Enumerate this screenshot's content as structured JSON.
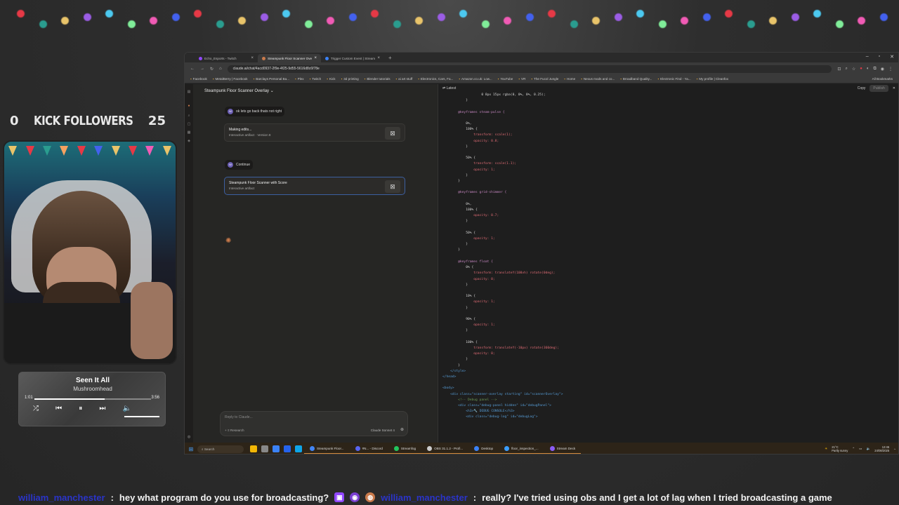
{
  "overlay": {
    "followers_left": "0",
    "followers_label": "KICK FOLLOWERS",
    "followers_right": "25"
  },
  "music": {
    "title": "Seen It All",
    "artist": "Mushroomhead",
    "elapsed": "1:01",
    "duration": "3:56",
    "progress": 0.6,
    "icons": [
      "shuffle-icon",
      "previous-icon",
      "pause-icon",
      "next-icon",
      "volume-icon"
    ]
  },
  "browser": {
    "tabs": [
      {
        "label": "Echo_Esports - Twitch",
        "active": false
      },
      {
        "label": "Steampunk Floor Scanner Ove",
        "active": true
      },
      {
        "label": "Trigger Custom Event | Stream",
        "active": false
      }
    ],
    "new_tab": "+",
    "url": "claude.ai/chat/4acd0937-2f9e-4f25-9d55-5616d8c6f78e",
    "bookmarks": [
      "Facebook",
      "MetalBerry | Facebook",
      "Barclays Personal Ba...",
      "Plex",
      "Twitch",
      "Kick",
      "3d printing",
      "Blender tutorials",
      "ai art stuff",
      "Electronics, Cars, Fa...",
      "Amazon.co.uk: Low...",
      "YouTube",
      "VR",
      "The Fucol Jungle",
      "Home",
      "Nexus mods and co...",
      "Broadband Quality...",
      "Electronic Find - Ya...",
      "My profile | Cleanfox"
    ],
    "all_bookmarks": "All Bookmarks"
  },
  "claude": {
    "chat_title": "Steampunk Floor Scanner Overlay",
    "messages": [
      {
        "avatar": "W",
        "text": "ok lets go back thats not right"
      },
      {
        "avatar": "W",
        "text": "Continue"
      }
    ],
    "artifacts": [
      {
        "title": "Making edits...",
        "subtitle": "Interactive artifact · Version 8"
      },
      {
        "title": "Steampunk Floor Scanner with Score",
        "subtitle": "Interactive artifact"
      }
    ],
    "reply_placeholder": "Reply to Claude...",
    "tools_label": "+ ≡ Research",
    "model_label": "Claude Sonnet 4",
    "code_panel": {
      "version": "Latest",
      "copy": "Copy",
      "publish": "Publish",
      "lines": [
        "                    0 8px 15px rgba(0, 0%, 0%, 0.25);",
        "            }",
        "",
        "        @keyframes steam-pulse {",
        "",
        "            0%,",
        "            100% {",
        "                transform: scale(1);",
        "                opacity: 0.8;",
        "            }",
        "",
        "            50% {",
        "                transform: scale(1.1);",
        "                opacity: 1;",
        "            }",
        "        }",
        "",
        "        @keyframes grid-shimmer {",
        "",
        "            0%,",
        "            100% {",
        "                opacity: 0.7;",
        "            }",
        "",
        "            50% {",
        "                opacity: 1;",
        "            }",
        "        }",
        "",
        "        @keyframes float {",
        "            0% {",
        "                transform: translateY(100vh) rotate(0deg);",
        "                opacity: 0;",
        "            }",
        "",
        "            10% {",
        "                opacity: 1;",
        "            }",
        "",
        "            90% {",
        "                opacity: 1;",
        "            }",
        "",
        "            100% {",
        "                transform: translateY(-10px) rotate(360deg);",
        "                opacity: 0;",
        "            }",
        "        }",
        "    </style>",
        "</head>",
        "",
        "<body>",
        "    <div class=\"scanner-overlay starting\" id=\"scannerOverlay\">",
        "        <!-- Debug panel -->",
        "        <div class=\"debug-panel hidden\" id=\"debugPanel\">",
        "            <h3>🔧 DEBUG CONSOLE</h3>",
        "            <div class=\"debug-log\" id=\"debugLog\">"
      ]
    }
  },
  "taskbar": {
    "search": "Search",
    "apps": [
      {
        "label": "Steampunk Floor...",
        "color": "#4285f4"
      },
      {
        "label": "#N... - Discord",
        "color": "#5865f2"
      },
      {
        "label": "Streamfog",
        "color": "#22c55e"
      },
      {
        "label": "OBS 31.1.2 - Profi...",
        "color": "#cccccc"
      },
      {
        "label": "Desktop",
        "color": "#3b82f6"
      },
      {
        "label": "floor_inspection_...",
        "color": "#3b9eff"
      },
      {
        "label": "Stream Deck",
        "color": "#8b5cf6"
      }
    ],
    "weather_temp": "21°C",
    "weather_desc": "Partly sunny",
    "time": "12:45",
    "date": "24/08/2025"
  },
  "chat": {
    "messages": [
      {
        "user": "william_manchester",
        "text": "hey what program do you use for broadcasting?"
      },
      {
        "user": "william_manchester",
        "text": "really? I've tried using obs and I get a lot of lag when I tried broadcasting a game"
      }
    ]
  },
  "colors": {
    "accent": "#c97a4b",
    "chat_user": "#2a34c8",
    "bokeh": [
      "#e63946",
      "#2a9d8f",
      "#e9c46a",
      "#9b5de5",
      "#4cc9f0",
      "#80ed99",
      "#f15bb5",
      "#4361ee"
    ]
  }
}
